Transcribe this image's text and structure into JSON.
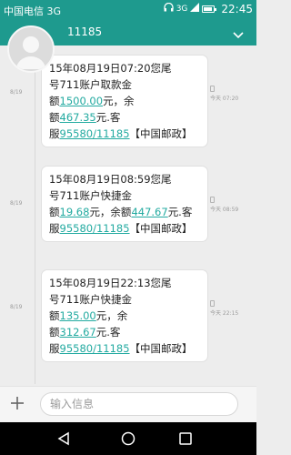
{
  "status_bar": {
    "carrier": "中国电信 3G",
    "network_badge": "3G",
    "time": "22:45",
    "icons": [
      "headset-icon",
      "network-3g-icon",
      "signal-icon",
      "battery-icon"
    ],
    "battery_level": 0.9
  },
  "header": {
    "title": "11185",
    "expand_icon": "chevron-down-icon"
  },
  "messages": [
    {
      "date": "8/19",
      "time": "今天 07:20",
      "lines": [
        [
          {
            "t": "15年08月19日07:20您尾"
          }
        ],
        [
          {
            "t": "号711账户取款金"
          }
        ],
        [
          {
            "t": "额"
          },
          {
            "t": "1500.00",
            "link": true
          },
          {
            "t": "元，余"
          }
        ],
        [
          {
            "t": "额"
          },
          {
            "t": "467.35",
            "link": true
          },
          {
            "t": "元.客"
          }
        ],
        [
          {
            "t": "服"
          },
          {
            "t": "95580/11185",
            "link": true
          },
          {
            "t": "【中国邮政】"
          }
        ]
      ]
    },
    {
      "date": "8/19",
      "time": "今天 08:59",
      "lines": [
        [
          {
            "t": "15年08月19日08:59您尾"
          }
        ],
        [
          {
            "t": "号711账户快捷金"
          }
        ],
        [
          {
            "t": "额"
          },
          {
            "t": "19.68",
            "link": true
          },
          {
            "t": "元，余额"
          },
          {
            "t": "447.67",
            "link": true
          },
          {
            "t": "元.客"
          }
        ],
        [
          {
            "t": "服"
          },
          {
            "t": "95580/11185",
            "link": true
          },
          {
            "t": "【中国邮政】"
          }
        ]
      ]
    },
    {
      "date": "8/19",
      "time": "今天 22:15",
      "lines": [
        [
          {
            "t": "15年08月19日22:13您尾"
          }
        ],
        [
          {
            "t": "号711账户快捷金"
          }
        ],
        [
          {
            "t": "额"
          },
          {
            "t": "135.00",
            "link": true
          },
          {
            "t": "元，余"
          }
        ],
        [
          {
            "t": "额"
          },
          {
            "t": "312.67",
            "link": true
          },
          {
            "t": "元.客"
          }
        ],
        [
          {
            "t": "服"
          },
          {
            "t": "95580/11185",
            "link": true
          },
          {
            "t": "【中国邮政】"
          }
        ]
      ]
    }
  ],
  "composer": {
    "placeholder": "输入信息",
    "add_icon": "plus-icon"
  },
  "nav_bar": {
    "buttons": [
      "back-triangle-icon",
      "home-circle-icon",
      "recents-square-icon"
    ]
  },
  "colors": {
    "accent": "#1e9a8e",
    "link": "#22aaa0",
    "background": "#ededed"
  }
}
